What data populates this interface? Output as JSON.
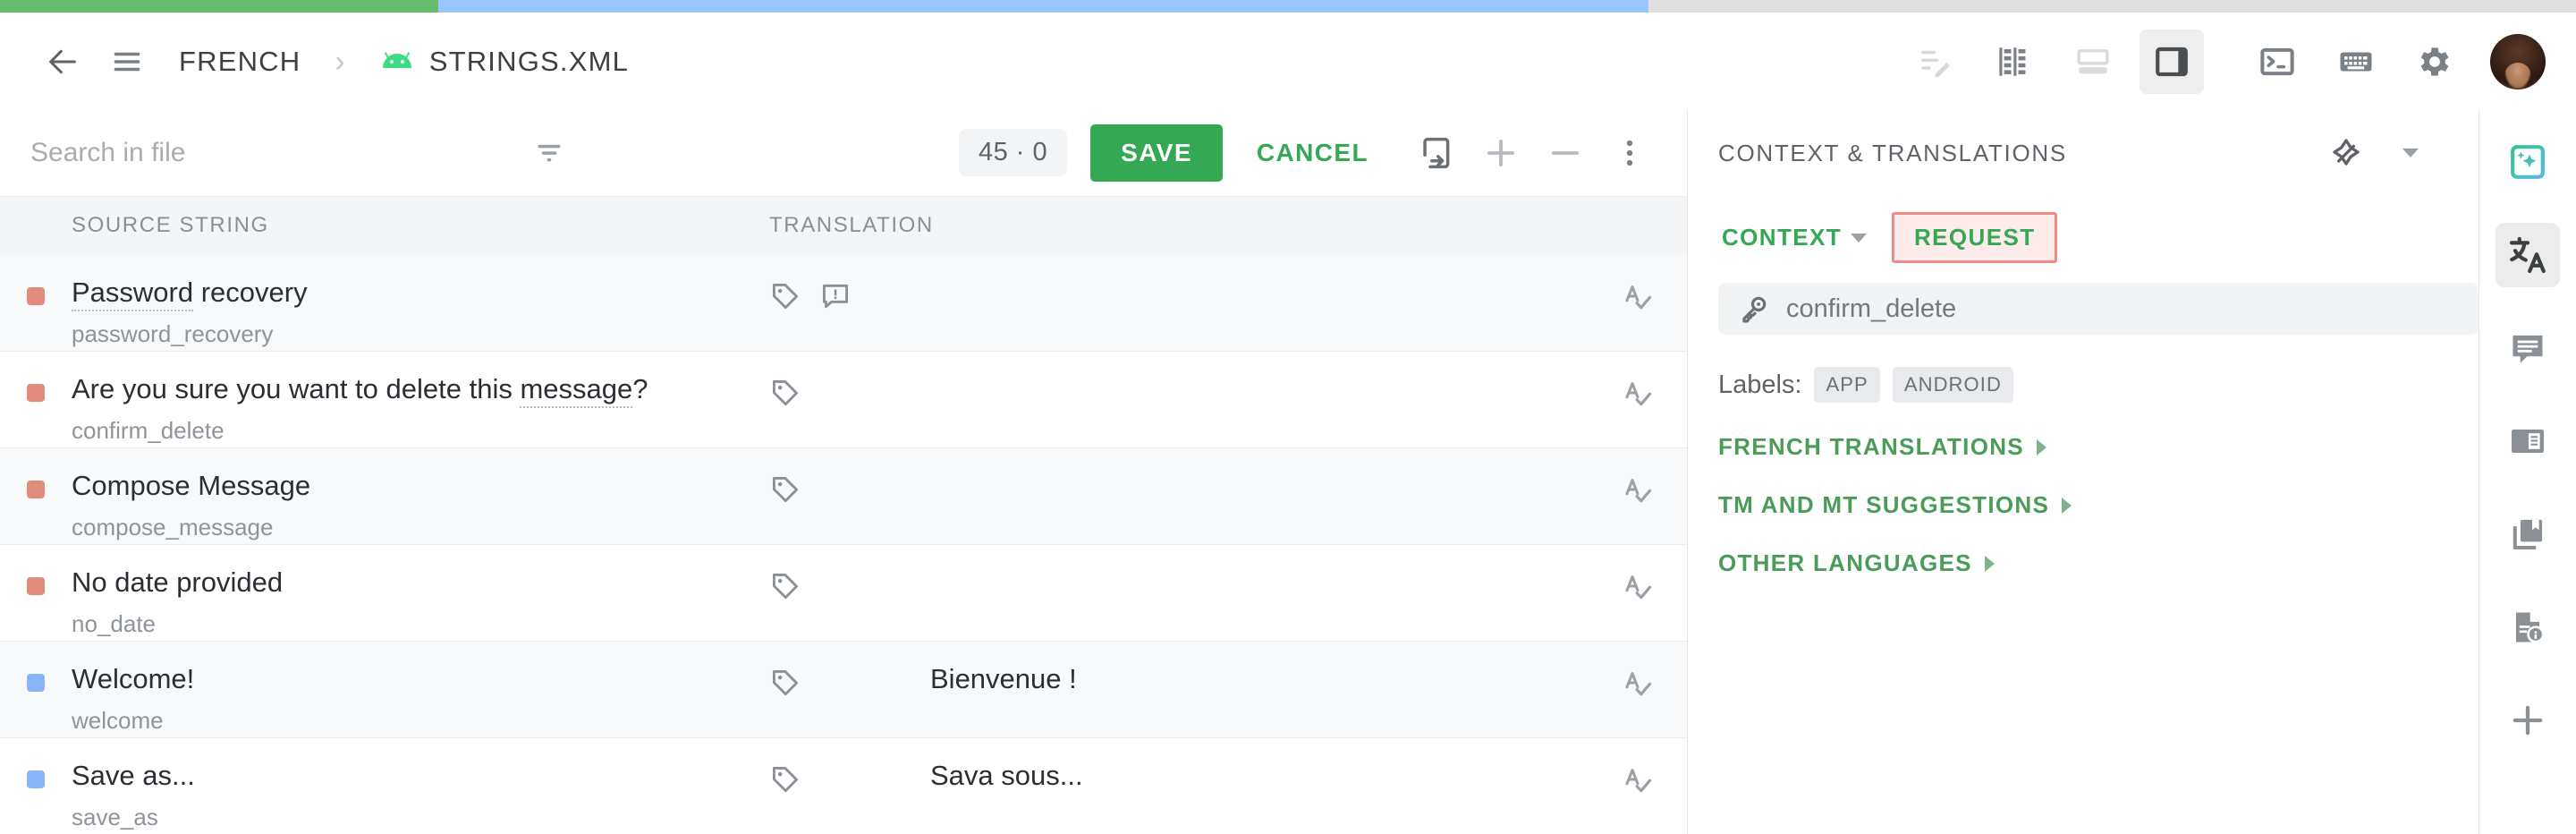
{
  "progress": {
    "green_pct": 17.0,
    "blue_pct": 47.0,
    "grey_pct": 36.0,
    "green_color": "#68bd6d",
    "blue_color": "#99c6fc",
    "grey_color": "#e0e0e0"
  },
  "appbar": {
    "back_icon": "arrow-left-icon",
    "menu_icon": "hamburger-menu-icon",
    "breadcrumb_language": "FRENCH",
    "breadcrumb_separator": "›",
    "platform_icon": "android-robot-icon",
    "breadcrumb_file": "STRINGS.XML",
    "tools": [
      {
        "name": "edit-lines-icon",
        "title": "Edit"
      },
      {
        "name": "columns-layout-icon",
        "title": "Columns layout"
      },
      {
        "name": "rows-layout-icon",
        "title": "Rows layout"
      },
      {
        "name": "split-layout-icon",
        "title": "Split layout",
        "active": true
      },
      {
        "name": "terminal-icon",
        "title": "Terminal"
      },
      {
        "name": "keyboard-icon",
        "title": "Keyboard shortcuts"
      },
      {
        "name": "gear-icon",
        "title": "Settings"
      }
    ],
    "avatar_alt": "user-avatar"
  },
  "toolbar": {
    "search_placeholder": "Search in file",
    "search_value": "",
    "filter_icon": "filter-icon",
    "count_chip": "45 · 0",
    "save_label": "SAVE",
    "cancel_label": "CANCEL",
    "copy_icon": "copy-to-device-icon",
    "plus_icon": "plus-icon",
    "minus_icon": "minus-icon",
    "more_icon": "more-vertical-icon",
    "save_color": "#34a853"
  },
  "table": {
    "columns": [
      "SOURCE STRING",
      "TRANSLATION"
    ],
    "rows": [
      {
        "status": "untranslated",
        "source": "Password recovery",
        "spell_word": "Password recovery",
        "spell_part": "Password",
        "key": "password_recovery",
        "translation": "",
        "icons": [
          "tag-icon",
          "comment-alert-icon"
        ],
        "action_icon": "spellcheck-icon"
      },
      {
        "status": "untranslated",
        "source": "Are you sure you want to delete this message?",
        "spell_part": "message",
        "key": "confirm_delete",
        "translation": "",
        "icons": [
          "tag-icon"
        ],
        "action_icon": "spellcheck-icon"
      },
      {
        "status": "untranslated",
        "source": "Compose Message",
        "spell_part": "",
        "key": "compose_message",
        "translation": "",
        "icons": [
          "tag-icon"
        ],
        "action_icon": "spellcheck-icon"
      },
      {
        "status": "untranslated",
        "source": "No date provided",
        "spell_part": "",
        "key": "no_date",
        "translation": "",
        "icons": [
          "tag-icon"
        ],
        "action_icon": "spellcheck-icon"
      },
      {
        "status": "translated",
        "source": "Welcome!",
        "spell_part": "",
        "key": "welcome",
        "translation": "Bienvenue !",
        "icons": [
          "tag-icon"
        ],
        "action_icon": "spellcheck-icon"
      },
      {
        "status": "translated",
        "source": "Save as...",
        "spell_part": "",
        "key": "save_as",
        "translation": "Sava sous...",
        "icons": [
          "tag-icon"
        ],
        "action_icon": "spellcheck-icon"
      }
    ],
    "status_colors": {
      "untranslated": "#e28b7c",
      "translated": "#8ab4f8"
    }
  },
  "context_panel": {
    "title": "CONTEXT & TRANSLATIONS",
    "pin_icon": "pin-icon",
    "collapse_icon": "chevron-down-icon",
    "tab_context": "CONTEXT",
    "tab_request": "REQUEST",
    "highlight_border": "#f08a85",
    "highlight_fill": "#fdeceb",
    "key_icon": "key-icon",
    "key_name": "confirm_delete",
    "labels_word": "Labels:",
    "labels": [
      "APP",
      "ANDROID"
    ],
    "links": [
      {
        "label": "FRENCH TRANSLATIONS"
      },
      {
        "label": "TM AND MT SUGGESTIONS"
      },
      {
        "label": "OTHER LANGUAGES"
      }
    ],
    "link_color": "#4a9c58"
  },
  "right_rail": [
    {
      "name": "ai-sparkle-icon",
      "active": false
    },
    {
      "name": "translate-icon",
      "active": true
    },
    {
      "name": "comment-icon",
      "active": false
    },
    {
      "name": "glossary-icon",
      "active": false
    },
    {
      "name": "library-icon",
      "active": false
    },
    {
      "name": "file-info-icon",
      "active": false
    },
    {
      "name": "add-icon",
      "active": false
    }
  ]
}
